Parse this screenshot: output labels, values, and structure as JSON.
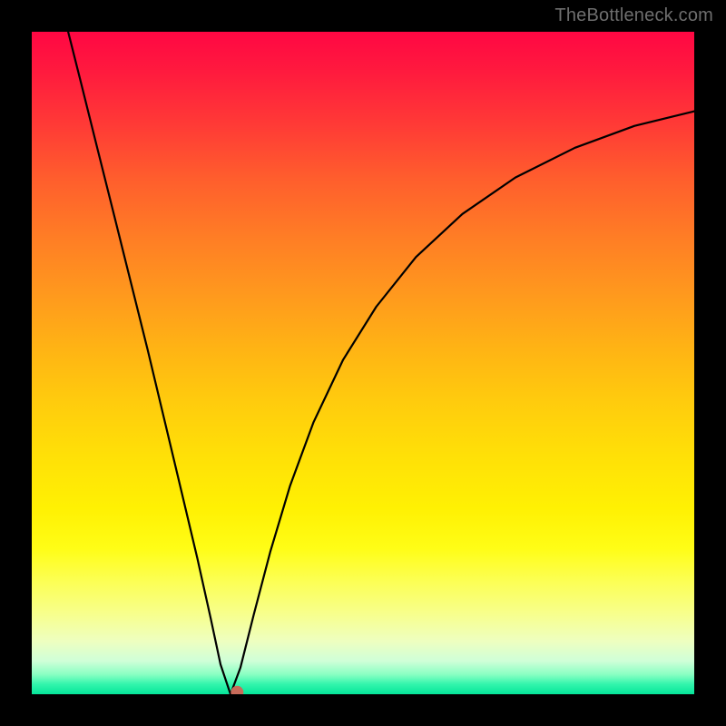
{
  "watermark": "TheBottleneck.com",
  "chart_data": {
    "type": "line",
    "title": "",
    "xlabel": "",
    "ylabel": "",
    "xlim": [
      0,
      1
    ],
    "ylim": [
      0,
      1
    ],
    "curve": {
      "comment": "Approximate min-curve. y≈1 is top (red), y≈0 is bottom (green). Minimum near x≈0.30.",
      "points": [
        {
          "x": 0.055,
          "y": 1.0
        },
        {
          "x": 0.075,
          "y": 0.92
        },
        {
          "x": 0.1,
          "y": 0.82
        },
        {
          "x": 0.125,
          "y": 0.72
        },
        {
          "x": 0.15,
          "y": 0.62
        },
        {
          "x": 0.175,
          "y": 0.52
        },
        {
          "x": 0.2,
          "y": 0.415
        },
        {
          "x": 0.225,
          "y": 0.31
        },
        {
          "x": 0.25,
          "y": 0.205
        },
        {
          "x": 0.27,
          "y": 0.115
        },
        {
          "x": 0.285,
          "y": 0.045
        },
        {
          "x": 0.3,
          "y": 0.0
        },
        {
          "x": 0.315,
          "y": 0.04
        },
        {
          "x": 0.335,
          "y": 0.12
        },
        {
          "x": 0.36,
          "y": 0.215
        },
        {
          "x": 0.39,
          "y": 0.315
        },
        {
          "x": 0.425,
          "y": 0.41
        },
        {
          "x": 0.47,
          "y": 0.505
        },
        {
          "x": 0.52,
          "y": 0.585
        },
        {
          "x": 0.58,
          "y": 0.66
        },
        {
          "x": 0.65,
          "y": 0.725
        },
        {
          "x": 0.73,
          "y": 0.78
        },
        {
          "x": 0.82,
          "y": 0.825
        },
        {
          "x": 0.91,
          "y": 0.858
        },
        {
          "x": 1.0,
          "y": 0.88
        }
      ]
    },
    "marker": {
      "x": 0.31,
      "y": 0.003,
      "color": "#c86b5a",
      "radius_px": 7
    },
    "background_gradient": {
      "top_color": "#ff0743",
      "mid_color": "#ffe007",
      "bottom_color": "#05e59a"
    },
    "frame_color": "#000000"
  }
}
